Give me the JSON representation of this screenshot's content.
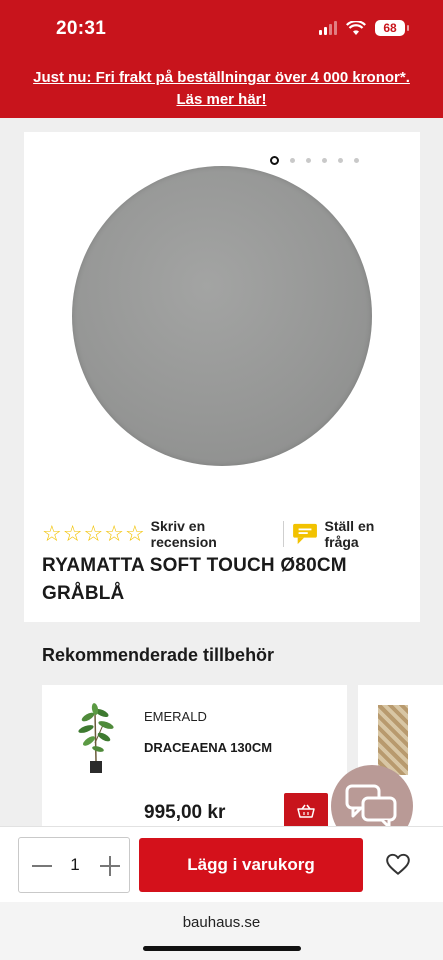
{
  "status_bar": {
    "time": "20:31",
    "battery": "68"
  },
  "promo": {
    "line1": "Just nu: Fri frakt på beställningar över 4 000 kronor*.",
    "line2": "Läs mer här!"
  },
  "product": {
    "title_line1": "RYAMATTA SOFT TOUCH Ø80CM",
    "title_line2": "GRÅBLÅ",
    "rating": 0,
    "review_link": "Skriv en recension",
    "question_link": "Ställ en fråga",
    "gallery": {
      "image_count": 6,
      "active_index": 0
    }
  },
  "recommended": {
    "heading": "Rekommenderade tillbehör",
    "items": [
      {
        "brand": "EMERALD",
        "name": "DRACEAENA 130CM",
        "price": "995,00 kr"
      }
    ]
  },
  "bottom_bar": {
    "quantity": "1",
    "add_to_cart_label": "Lägg i varukorg"
  },
  "browser": {
    "url": "bauhaus.se"
  },
  "colors": {
    "brand_red": "#c8141c",
    "star_yellow": "#f2c200"
  }
}
